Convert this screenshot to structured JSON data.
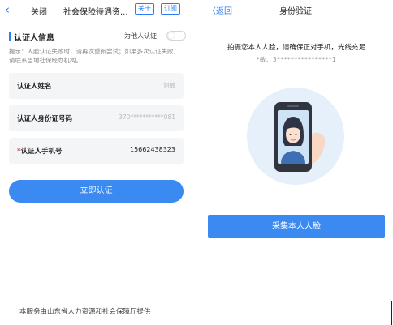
{
  "left": {
    "nav": {
      "back_icon": "chevron-left-icon",
      "close": "关闭",
      "title": "社会保险待遇资...",
      "about": "关于",
      "subscribe": "订阅"
    },
    "section_title": "认证人信息",
    "other_person_label": "为他人认证",
    "other_person_enabled": false,
    "tip": "提示：人脸认证失败时，请再次重新尝试；如果多次认证失败，请联系当地社保经办机构。",
    "fields": {
      "name": {
        "label": "认证人姓名",
        "value": "刘敏"
      },
      "id": {
        "label": "认证人身份证号码",
        "value": "370***********081"
      },
      "phone": {
        "required_mark": "*",
        "label": "认证人手机号",
        "value": "15662438323"
      }
    },
    "submit_label": "立即认证",
    "footer": "本服务由山东省人力资源和社会保障厅提供"
  },
  "right": {
    "nav": {
      "back": "〈返回",
      "title": "身份验证"
    },
    "instruction": "拍摄您本人人脸，请确保正对手机，光线充足",
    "masked_id": "*敏、3****************1",
    "collect_label": "采集本人人脸"
  },
  "colors": {
    "accent": "#3a8af2",
    "field_bg": "#f4f5f7"
  }
}
